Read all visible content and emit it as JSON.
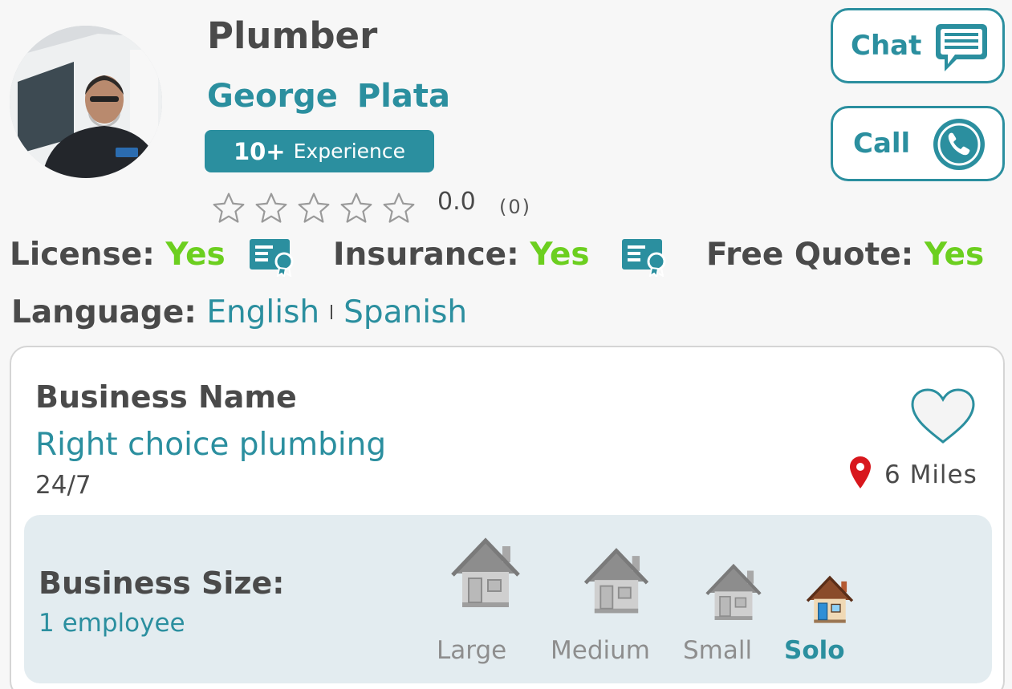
{
  "profile": {
    "trade": "Plumber",
    "name": "George  Plata",
    "experience_number": "10+",
    "experience_label": "Experience",
    "rating": "0.0",
    "review_count": "(0)",
    "stars_filled": 0,
    "stars_total": 5
  },
  "actions": {
    "chat_label": "Chat",
    "call_label": "Call"
  },
  "qualifications": {
    "license_label": "License:",
    "license_value": "Yes",
    "insurance_label": "Insurance:",
    "insurance_value": "Yes",
    "free_quote_label": "Free Quote:",
    "free_quote_value": "Yes"
  },
  "languages": {
    "label": "Language:",
    "items": [
      "English",
      "Spanish"
    ]
  },
  "business": {
    "name_label": "Business Name",
    "name": "Right choice plumbing",
    "hours": "24/7",
    "distance": "6 Miles",
    "size_label": "Business Size:",
    "size_value": "1 employee",
    "sizes": [
      "Large",
      "Medium",
      "Small",
      "Solo"
    ],
    "selected_size": "Solo"
  },
  "colors": {
    "accent": "#2b8f9f",
    "yes_green": "#6ccf1f",
    "text": "#4a4a4a",
    "panel": "#e3ecf0",
    "pin_red": "#d8171d"
  },
  "icons": [
    "star-outline-icon",
    "chat-bubble-icon",
    "phone-icon",
    "certificate-icon",
    "heart-outline-icon",
    "location-pin-icon",
    "house-icon"
  ]
}
